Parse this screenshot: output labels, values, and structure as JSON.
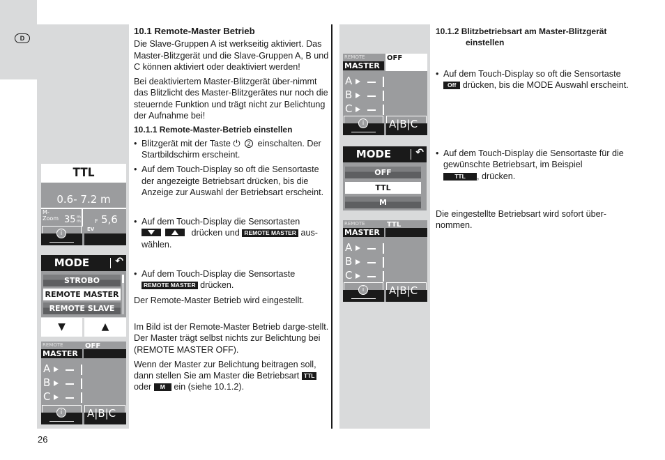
{
  "page": {
    "language_badge": "D",
    "page_number": "26"
  },
  "left_column": {
    "heading": "10.1 Remote-Master Betrieb",
    "intro_paragraph_1": "Die Slave-Gruppen A ist werkseitig aktiviert. Das Master-Blitzgerät und die Slave-Gruppen A, B und C können aktiviert oder deaktiviert werden!",
    "intro_paragraph_2": "Bei deaktiviertem Master-Blitzgerät über-nimmt das Blitzlicht des Master-Blitzgerätes nur noch die steuernde Funktion und trägt nicht zur Belichtung der Aufnahme bei!",
    "subheading": "10.1.1 Remote-Master-Betrieb einstellen",
    "step_1_before": "Blitzgerät mit der Taste",
    "step_1_power_symbol": "⏻",
    "step_1_number": "2",
    "step_1_after": "einschalten. Der Startbildschirm erscheint.",
    "step_2": "Auf dem Touch-Display so oft die Sensortaste der angezeigte Betriebsart drücken, bis die Anzeige zur Auswahl der Betriebsart erscheint.",
    "step_3_before": "Auf dem Touch-Display die Sensortasten",
    "step_3_middle": "drücken und",
    "step_3_key": "REMOTE MASTER",
    "step_3_after": "aus-wählen.",
    "step_4_before": "Auf dem Touch-Display die Sensortaste",
    "step_4_key": "REMOTE MASTER",
    "step_4_after": "drücken.",
    "result_text": "Der Remote-Master Betrieb wird eingestellt.",
    "note_paragraph_1": "Im Bild ist der Remote-Master Betrieb darge-stellt. Der Master trägt selbst nichts zur Belichtung bei (REMOTE MASTER OFF).",
    "note_paragraph_2_before": "Wenn der Master zur Belichtung beitragen soll, dann stellen Sie am Master die Betriebsart",
    "note_key_ttl": "TTL",
    "note_or": "oder",
    "note_key_m": "M",
    "note_paragraph_2_after": "ein (siehe 10.1.2)."
  },
  "right_column": {
    "subheading": "10.1.2 Blitzbetriebsart am Master-Blitzgerät einstellen",
    "step_1_before": "Auf dem Touch-Display so oft die Sensortaste",
    "step_1_key": "Off",
    "step_1_after": "drücken, bis die MODE Auswahl erscheint.",
    "step_2_before": "Auf dem Touch-Display die Sensortaste für die gewünschte Betriebsart, im Beispiel",
    "step_2_key": "TTL",
    "step_2_after": ", drücken.",
    "result_text": "Die eingestellte Betriebsart wird sofort über-nommen."
  },
  "ttl_display": {
    "title": "TTL",
    "range": "0.6- 7.2 m",
    "zoom_label_line1": "M-",
    "zoom_label_line2": "Zoom",
    "zoom_value": "35",
    "zoom_unit_top": "m",
    "zoom_unit_bottom": "m",
    "f_label": "F",
    "f_value": "5,6",
    "info_icon": "i",
    "ev_label": "EV"
  },
  "mode_display_1": {
    "title": "MODE",
    "back_icon": "↶",
    "items": [
      "STROBO",
      "REMOTE MASTER",
      "REMOTE SLAVE"
    ],
    "selected_index": 1,
    "down_arrow": "▼",
    "up_arrow": "▲"
  },
  "mode_display_2": {
    "title": "MODE",
    "back_icon": "↶",
    "items": [
      "OFF",
      "TTL",
      "M"
    ],
    "selected_index": 1
  },
  "remote_master_displays": [
    {
      "remote_label": "REMOTE",
      "master_label": "MASTER",
      "status": "OFF",
      "groups": [
        "A",
        "B",
        "C"
      ],
      "group_value": "—",
      "info_icon": "i",
      "abc_label": "A|B|C"
    },
    {
      "remote_label": "REMOTE",
      "master_label": "MASTER",
      "status": "OFF",
      "groups": [
        "A",
        "B",
        "C"
      ],
      "group_value": "—",
      "info_icon": "i",
      "abc_label": "A|B|C"
    },
    {
      "remote_label": "REMOTE",
      "master_label": "MASTER",
      "status": "TTL",
      "groups": [
        "A",
        "B",
        "C"
      ],
      "group_value": "—",
      "info_icon": "i",
      "abc_label": "A|B|C"
    }
  ]
}
